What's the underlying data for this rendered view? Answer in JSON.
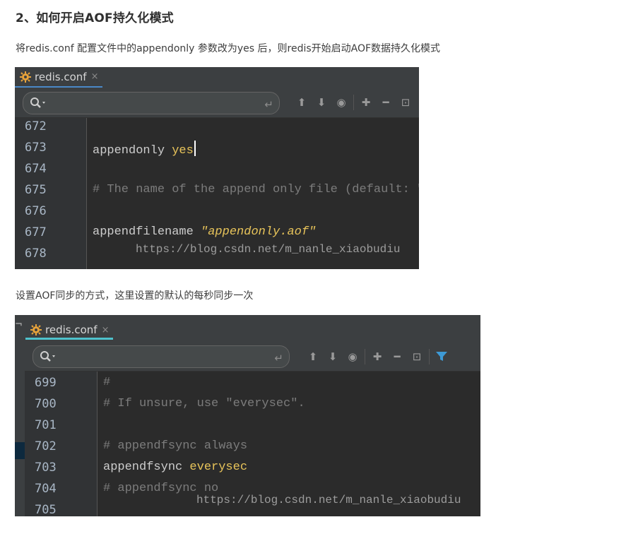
{
  "article": {
    "heading": "2、如何开启AOF持久化模式",
    "para1": "将redis.conf 配置文件中的appendonly 参数改为yes 后，则redis开始启动AOF数据持久化模式",
    "para2": "设置AOF同步的方式，这里设置的默认的每秒同步一次"
  },
  "editor1": {
    "tab_label": "redis.conf",
    "close_glyph": "×",
    "watermark": "https://blog.csdn.net/m_nanle_xiaobudiu",
    "lines": [
      {
        "num": "672",
        "kw": "",
        "val": "",
        "cmt": ""
      },
      {
        "num": "673",
        "kw": "appendonly ",
        "val": "yes",
        "cmt": ""
      },
      {
        "num": "674",
        "kw": "",
        "val": "",
        "cmt": ""
      },
      {
        "num": "675",
        "kw": "",
        "val": "",
        "cmt": "# The name of the append only file (default: \""
      },
      {
        "num": "676",
        "kw": "",
        "val": "",
        "cmt": ""
      },
      {
        "num": "677",
        "kw": "appendfilename ",
        "val": "\"appendonly.aof\"",
        "cmt": ""
      },
      {
        "num": "678",
        "kw": "",
        "val": "",
        "cmt": ""
      }
    ]
  },
  "editor2": {
    "tab_label": "redis.conf",
    "close_glyph": "×",
    "watermark": "https://blog.csdn.net/m_nanle_xiaobudiu",
    "lines": [
      {
        "num": "699",
        "kw": "",
        "val": "",
        "cmt": "#"
      },
      {
        "num": "700",
        "kw": "",
        "val": "",
        "cmt": "# If unsure, use \"everysec\"."
      },
      {
        "num": "701",
        "kw": "",
        "val": "",
        "cmt": ""
      },
      {
        "num": "702",
        "kw": "",
        "val": "",
        "cmt": "# appendfsync always"
      },
      {
        "num": "703",
        "kw": "appendfsync ",
        "val": "everysec",
        "cmt": ""
      },
      {
        "num": "704",
        "kw": "",
        "val": "",
        "cmt": "# appendfsync no"
      },
      {
        "num": "705",
        "kw": "",
        "val": "",
        "cmt": ""
      }
    ]
  },
  "colors": {
    "accent_tab1": "#4a88c7",
    "accent_tab2": "#4ec2cc",
    "value": "#e8c45a",
    "comment": "#7c7c7c",
    "filter": "#3d9ad6"
  }
}
